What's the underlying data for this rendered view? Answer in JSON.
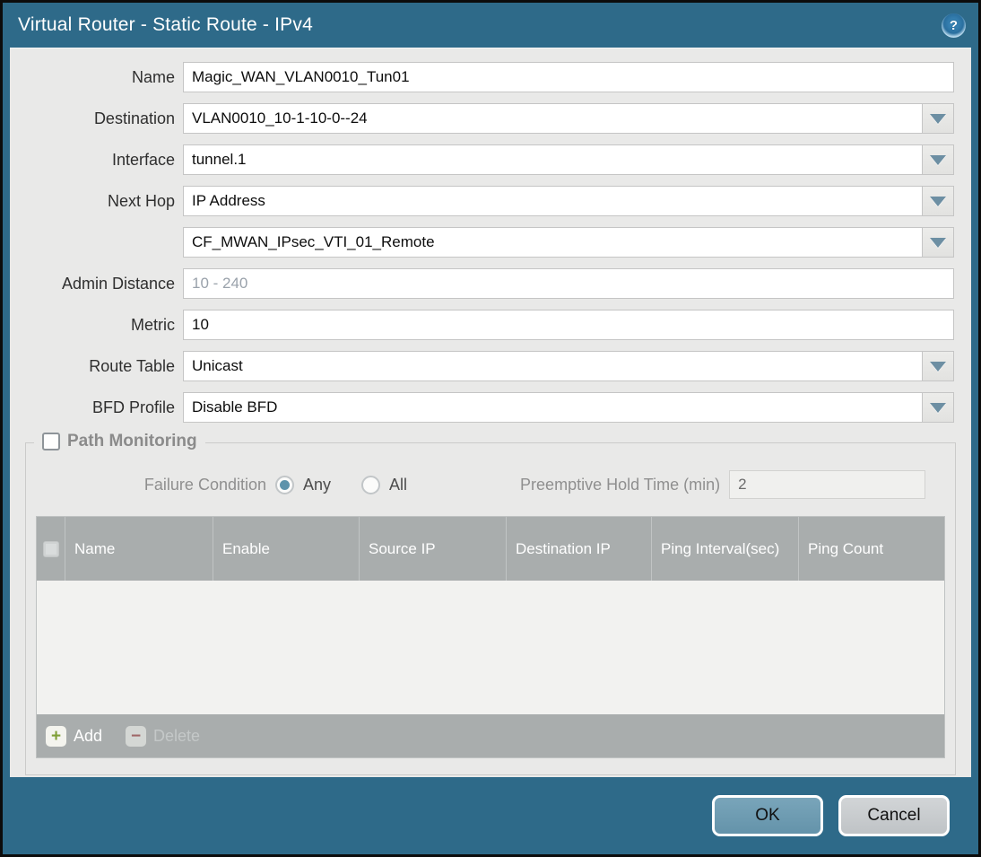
{
  "title": "Virtual Router - Static Route - IPv4",
  "icons": {
    "help_glyph": "?",
    "add_glyph": "+",
    "delete_glyph": "−"
  },
  "colors": {
    "frame_teal": "#2e6a89",
    "content_bg": "#e9e9e8",
    "table_header_bg": "#a9adad",
    "ok_button_bg": "#6e9cb2",
    "cancel_button_bg": "#c8cbce",
    "radio_selected": "#5e93ab",
    "add_icon_green": "#7f9f36",
    "delete_icon_red": "#9c5050"
  },
  "form": {
    "name": {
      "label": "Name",
      "value": "Magic_WAN_VLAN0010_Tun01"
    },
    "destination": {
      "label": "Destination",
      "value": "VLAN0010_10-1-10-0--24"
    },
    "interface": {
      "label": "Interface",
      "value": "tunnel.1"
    },
    "next_hop": {
      "label": "Next Hop",
      "value": "IP Address"
    },
    "next_hop_address": {
      "value": "CF_MWAN_IPsec_VTI_01_Remote"
    },
    "admin_distance": {
      "label": "Admin Distance",
      "value": "",
      "placeholder": "10 - 240"
    },
    "metric": {
      "label": "Metric",
      "value": "10"
    },
    "route_table": {
      "label": "Route Table",
      "value": "Unicast"
    },
    "bfd_profile": {
      "label": "BFD Profile",
      "value": "Disable BFD"
    }
  },
  "path_monitoring": {
    "label": "Path Monitoring",
    "checked": false,
    "failure_condition": {
      "label": "Failure Condition",
      "options": [
        "Any",
        "All"
      ],
      "selected": "Any"
    },
    "preemptive_hold_time": {
      "label": "Preemptive Hold Time (min)",
      "value": "2"
    },
    "table": {
      "columns": [
        "Name",
        "Enable",
        "Source IP",
        "Destination IP",
        "Ping Interval(sec)",
        "Ping Count"
      ],
      "rows": [],
      "add_label": "Add",
      "delete_label": "Delete",
      "delete_enabled": false
    }
  },
  "footer": {
    "ok_label": "OK",
    "cancel_label": "Cancel"
  }
}
